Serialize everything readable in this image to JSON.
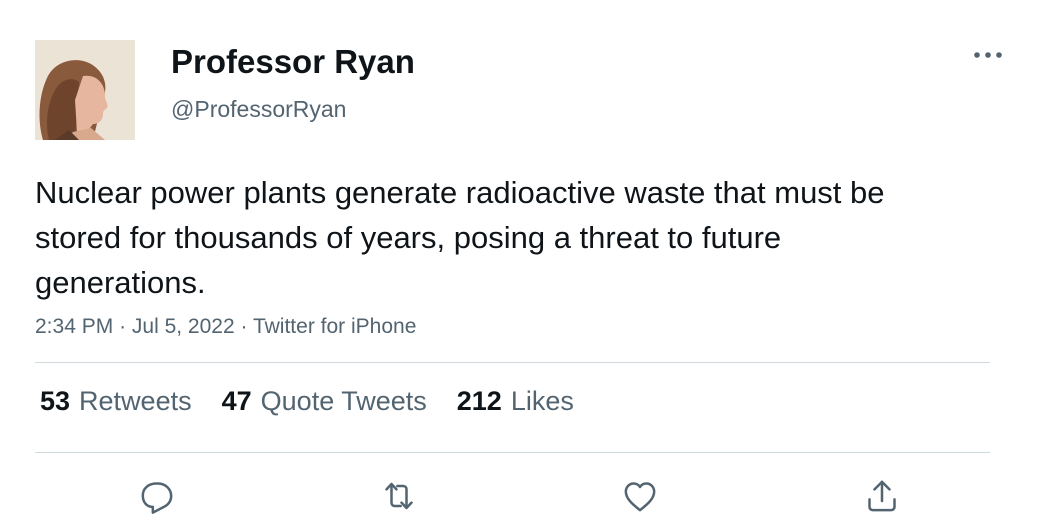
{
  "author": {
    "display_name": "Professor Ryan",
    "handle": "@ProfessorRyan",
    "avatar_icon": "profile-photo"
  },
  "tweet": {
    "text": "Nuclear power plants generate radioactive waste that must be stored for thousands of years, posing a threat to future generations.",
    "time": "2:34 PM",
    "date": "Jul 5, 2022",
    "source": "Twitter for iPhone",
    "separator": "·"
  },
  "stats": {
    "retweets": {
      "count": "53",
      "label": "Retweets"
    },
    "quote_tweets": {
      "count": "47",
      "label": "Quote Tweets"
    },
    "likes": {
      "count": "212",
      "label": "Likes"
    }
  },
  "actions": {
    "reply_icon": "reply-icon",
    "retweet_icon": "retweet-icon",
    "like_icon": "heart-icon",
    "share_icon": "share-icon"
  },
  "colors": {
    "text_primary": "#0f1419",
    "text_secondary": "#536471",
    "divider": "#cfd9de",
    "icon": "#536471"
  }
}
